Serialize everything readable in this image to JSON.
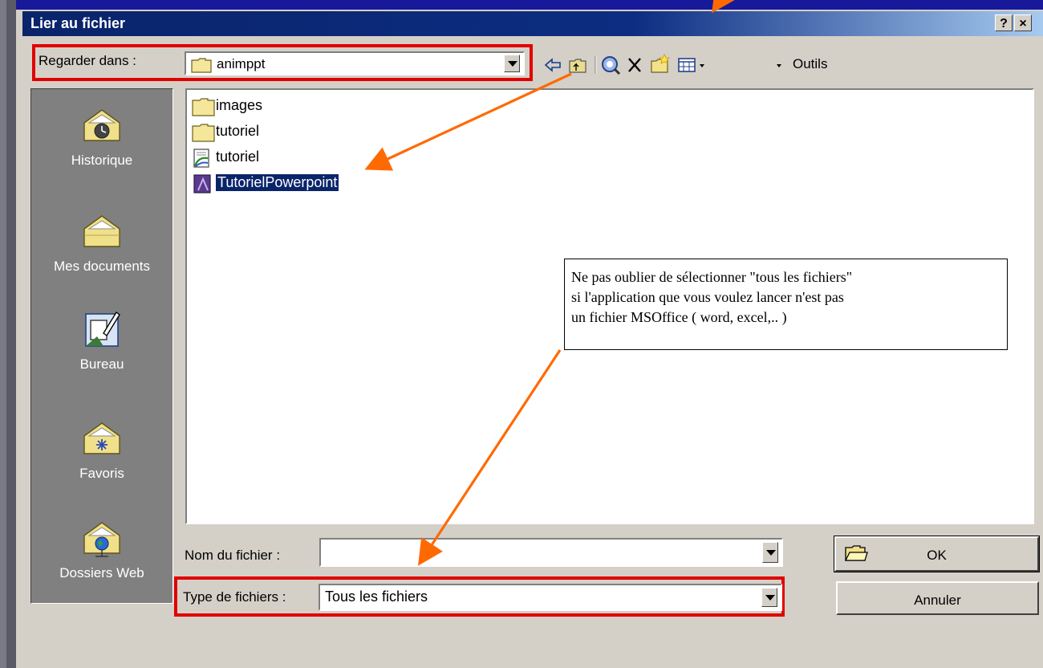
{
  "window": {
    "title": "Lier au fichier",
    "help_button": "?",
    "close_button": "×"
  },
  "lookin": {
    "label": "Regarder dans :",
    "value": "animppt"
  },
  "toolbar": {
    "tools_label": "Outils"
  },
  "places": [
    {
      "label": "Historique",
      "icon": "history-folder-icon"
    },
    {
      "label": "Mes documents",
      "icon": "my-documents-folder-icon"
    },
    {
      "label": "Bureau",
      "icon": "desktop-icon"
    },
    {
      "label": "Favoris",
      "icon": "favorites-folder-icon"
    },
    {
      "label": "Dossiers Web",
      "icon": "web-folders-icon"
    }
  ],
  "files": [
    {
      "name": "images",
      "type": "folder"
    },
    {
      "name": "tutoriel",
      "type": "folder"
    },
    {
      "name": "tutoriel",
      "type": "html-document"
    },
    {
      "name": "TutorielPowerpoint",
      "type": "powerpoint-document",
      "selected": true
    }
  ],
  "annotation": {
    "line1": "Ne pas oublier de sélectionner \"tous les fichiers\"",
    "line2": "si l'application que vous voulez lancer n'est pas",
    "line3": "un fichier MSOffice ( word, excel,.. )"
  },
  "form": {
    "filename_label": "Nom du fichier :",
    "filename_value": "",
    "filetype_label": "Type de fichiers :",
    "filetype_value": "Tous les fichiers"
  },
  "buttons": {
    "ok": "OK",
    "cancel": "Annuler"
  },
  "colors": {
    "highlight_frame": "#e00000",
    "arrow": "#ff6a00",
    "title_bar": "#0a246a",
    "dialog_bg": "#d4d0c8"
  }
}
